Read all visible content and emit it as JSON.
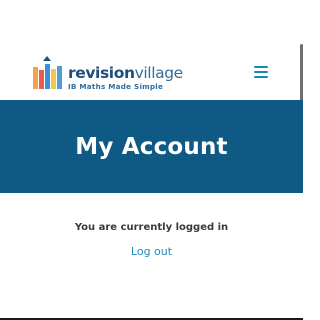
{
  "header": {
    "logo": {
      "name_strong": "revision",
      "name_light": "village",
      "tagline": "IB Maths Made Simple",
      "bar_colors": [
        "#f3a24a",
        "#e85d4f",
        "#3d8fd6",
        "#f1c94b",
        "#4a9fd8"
      ]
    },
    "menu_icon": "hamburger-menu-icon",
    "menu_color": "#1a87b3"
  },
  "hero": {
    "title": "My Account",
    "background": "#0e5a85"
  },
  "account": {
    "status_text": "You are currently logged in",
    "logout_label": "Log out",
    "link_color": "#1f8ac0"
  }
}
